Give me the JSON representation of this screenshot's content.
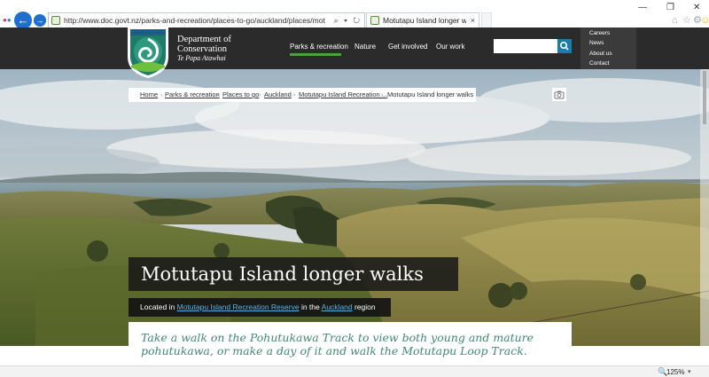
{
  "browser": {
    "url": "http://www.doc.govt.nz/parks-and-recreation/places-to-go/auckland/places/motutapu-island-r",
    "tab_title": "Motutapu Island longer walk...",
    "tab_close": "×",
    "back": "←",
    "forward": "→",
    "address_icons": "⌕ ▾ ↻",
    "window": {
      "minimize": "—",
      "maximize": "❐",
      "close": "✕"
    },
    "tools": {
      "home": "⌂",
      "favorites": "☆",
      "settings": "⚙",
      "feedback": "☺"
    },
    "zoom": "125%",
    "zoom_icon": "🔍",
    "zoom_caret": "▾"
  },
  "site": {
    "org_name_line1": "Department of",
    "org_name_line2": "Conservation",
    "org_subtitle": "Te Papa Atawhai",
    "main_nav": [
      "Parks & recreation",
      "Nature",
      "Get involved",
      "Our work"
    ],
    "search_placeholder": "",
    "utility_nav": [
      "Careers",
      "News",
      "About us",
      "Contact"
    ]
  },
  "breadcrumb": {
    "items": [
      "Home",
      "Parks & recreation",
      "Places to go",
      "Auckland",
      "Motutapu Island Recreation ..."
    ],
    "current": "Motutapu Island longer walks",
    "separator": "›"
  },
  "page": {
    "title": "Motutapu Island longer walks",
    "located_prefix": "Located in",
    "located_place": "Motutapu Island Recreation Reserve",
    "located_mid": "in the",
    "located_region": "Auckland",
    "located_suffix": "region",
    "intro": "Take a walk on the Pohutukawa Track to view both young and mature pohutukawa, or make a day of it and walk the Motutapu Loop Track."
  },
  "colors": {
    "header_bg": "#2b2b2b",
    "accent_green": "#4aa03f",
    "search_button": "#1a7cad",
    "link_blue": "#5fb0e0",
    "intro_text": "#3f8a70"
  }
}
